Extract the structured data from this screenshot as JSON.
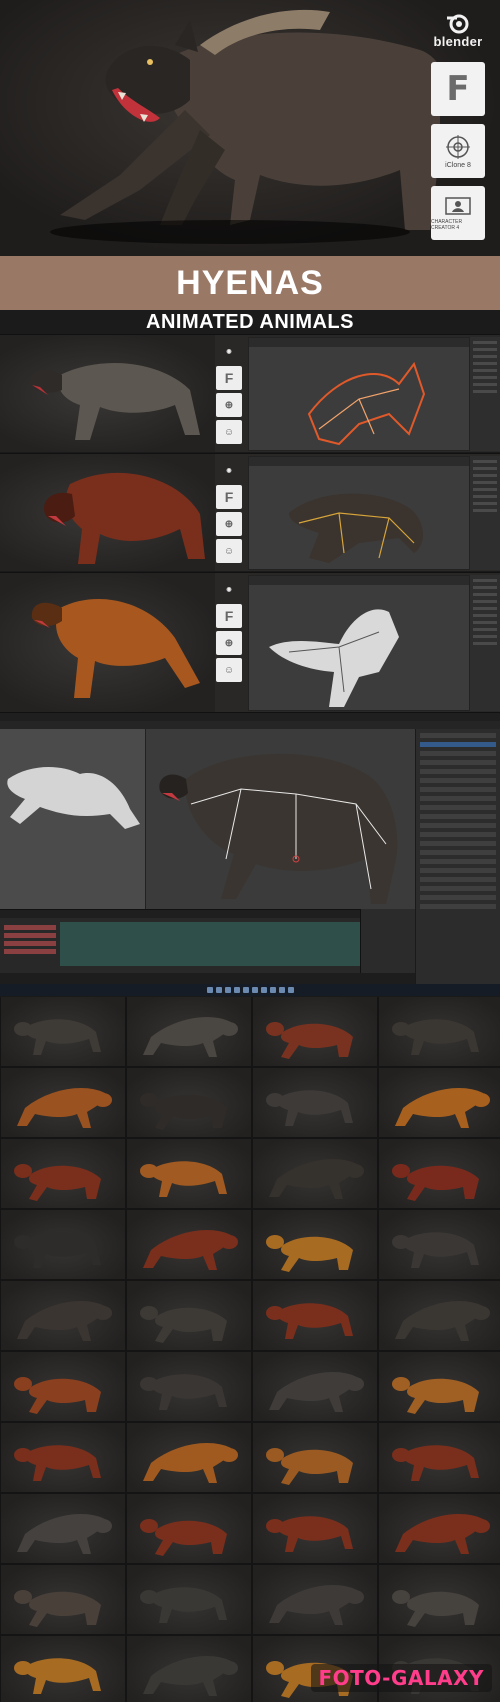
{
  "hero": {
    "logos": {
      "blender": "blender",
      "iclone": "iClone 8",
      "character_creator": "CHARACTER CREATOR 4"
    }
  },
  "title": "HYENAS",
  "subtitle": "ANIMATED ANIMALS",
  "variants": [
    {
      "name": "grey-spotted",
      "fur_color": "#5c5750",
      "rig_color": "#e0592a"
    },
    {
      "name": "red-brown",
      "fur_color": "#7a2e1c",
      "rig_color": "#d6a43a"
    },
    {
      "name": "orange",
      "fur_color": "#a8581f",
      "rig_color": "#cfcfcf"
    }
  ],
  "blender_window": {
    "accent_color": "#335a8a",
    "timeline_color": "#2f4f4a"
  },
  "pose_grid": {
    "columns": 4,
    "rows": 11,
    "fur_colors": [
      "#3e3a36",
      "#4a4641",
      "#7a3220",
      "#3a3632",
      "#9a5220",
      "#2f2b28",
      "#3d3a38",
      "#a8601f",
      "#7a2e1c",
      "#a05a22",
      "#35312d",
      "#7a2a1c",
      "#2e2c2a",
      "#7a2e1c",
      "#a86b22",
      "#3a3735",
      "#3a3530",
      "#3d3a36",
      "#7a2e1c",
      "#3a3733",
      "#8a3f1f",
      "#3a3633",
      "#3f3c3a",
      "#a06024",
      "#7a2e1c",
      "#a05a20",
      "#9a5a22",
      "#7a2e1c",
      "#44413e",
      "#7a2e1c",
      "#7a2e1c",
      "#7a2e1c",
      "#4a403a",
      "#3a3835",
      "#3d3a38",
      "#46423e",
      "#a86b22",
      "#3a3835",
      "#a86b22",
      "#3a3835",
      "#2e2c2a",
      "#2e2c2a",
      "#2e2c2a",
      "#2e2c2a"
    ]
  },
  "watermark": "FOTO-GALAXY"
}
